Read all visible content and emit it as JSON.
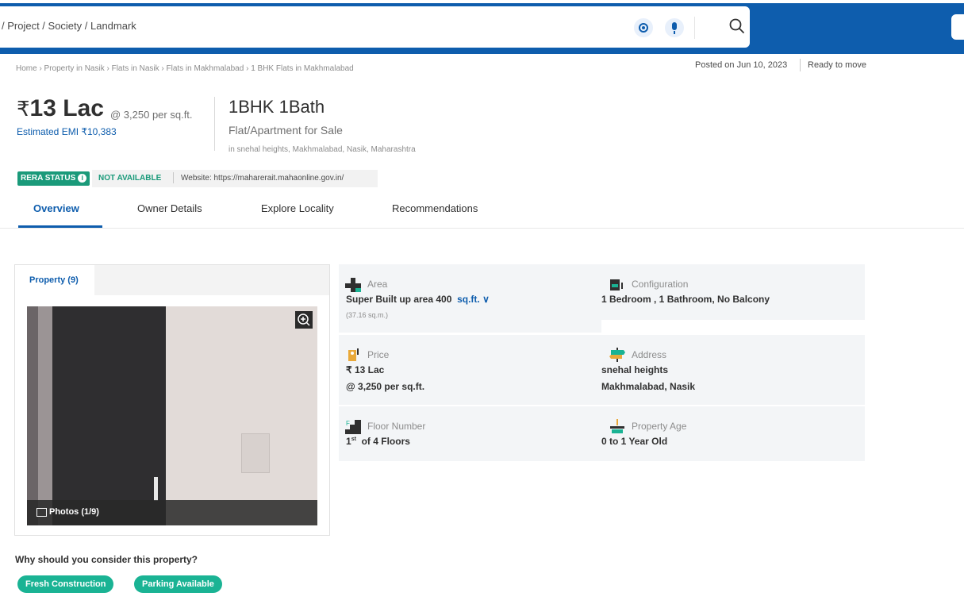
{
  "search": {
    "placeholder": "/ Project / Society / Landmark"
  },
  "breadcrumb": "Home › Property in Nasik › Flats in Nasik › Flats in Makhmalabad › 1 BHK Flats in Makhmalabad",
  "posted": {
    "date": "Posted on Jun 10, 2023",
    "status": "Ready to move"
  },
  "listing": {
    "rupee": "₹",
    "price": "13 Lac",
    "rate": "@ 3,250 per sq.ft.",
    "emi": "Estimated EMI ₹10,383",
    "title": "1BHK 1Bath",
    "subtitle": "Flat/Apartment for Sale",
    "location": "in snehal heights, Makhmalabad, Nasik, Maharashtra"
  },
  "rera": {
    "badge": "RERA STATUS",
    "status": "NOT AVAILABLE",
    "website": "Website: https://maharerait.mahaonline.gov.in/"
  },
  "tabs": [
    {
      "label": "Overview"
    },
    {
      "label": "Owner Details"
    },
    {
      "label": "Explore Locality"
    },
    {
      "label": "Recommendations"
    }
  ],
  "gallery": {
    "tab": "Property (9)",
    "photos": "Photos (1/9)"
  },
  "details": {
    "area": {
      "label": "Area",
      "value": "Super Built up area 400",
      "unit": "sq.ft.",
      "sub": "(37.16 sq.m.)"
    },
    "configuration": {
      "label": "Configuration",
      "value": "1 Bedroom , 1 Bathroom, No Balcony"
    },
    "price": {
      "label": "Price",
      "value": "₹ 13 Lac",
      "value2": "@ 3,250 per sq.ft."
    },
    "address": {
      "label": "Address",
      "value": "snehal heights",
      "value2": "Makhmalabad, Nasik"
    },
    "floor": {
      "label": "Floor Number",
      "floor_no": "1",
      "suffix": "st",
      "value": "of 4 Floors"
    },
    "age": {
      "label": "Property Age",
      "value": "0 to 1 Year Old"
    }
  },
  "why": {
    "heading": "Why should you consider this property?",
    "tags": [
      "Fresh Construction",
      "Parking Available"
    ]
  },
  "colors": {
    "brand": "#0e5dad",
    "accent_green": "#1ab394"
  }
}
